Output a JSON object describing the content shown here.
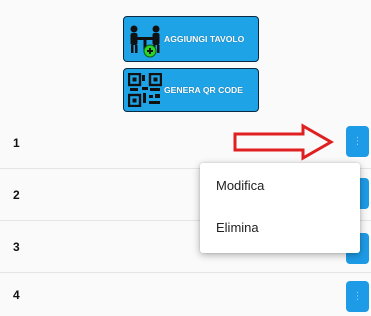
{
  "buttons": {
    "add_table": "AGGIUNGI TAVOLO",
    "generate_qr": "GENERA QR CODE"
  },
  "rows": [
    {
      "number": "1"
    },
    {
      "number": "2"
    },
    {
      "number": "3"
    },
    {
      "number": "4"
    }
  ],
  "row_menu_glyph": "⋮",
  "context_menu": {
    "items": [
      "Modifica",
      "Elimina"
    ]
  },
  "colors": {
    "button_blue": "#1ea3e6",
    "menu_button_blue": "#1e9be6",
    "arrow_red": "#e02020"
  },
  "icons": {
    "add_table": "people-at-table-with-plus-icon",
    "generate_qr": "qr-code-icon",
    "row_menu": "vertical-dots-icon",
    "annotation": "red-outline-arrow"
  }
}
